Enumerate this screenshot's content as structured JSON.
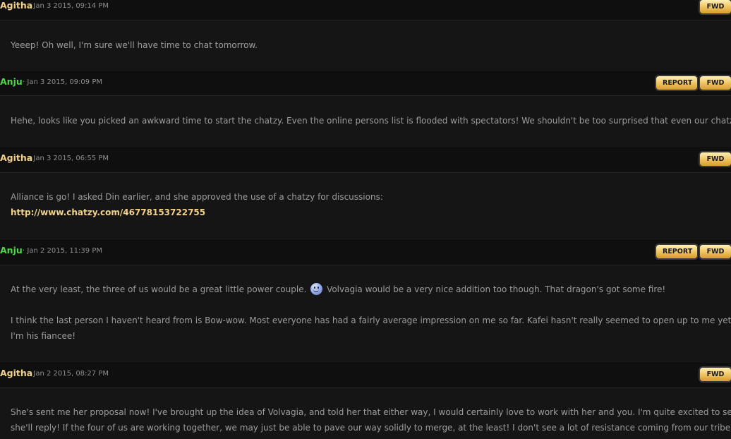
{
  "posts": [
    {
      "author": "Agitha",
      "author_color": "#f2d28a",
      "timestamp": "Jan 3 2015, 09:14 PM",
      "buttons": [
        "FWD"
      ],
      "lines": [
        "Yeeep! Oh well, I'm sure we'll have time to chat tomorrow."
      ]
    },
    {
      "author": "Anju",
      "author_color": "#4fd64a",
      "timestamp": "Jan 3 2015, 09:09 PM",
      "buttons": [
        "REPORT",
        "FWD"
      ],
      "lines": [
        "Hehe, looks like you picked an awkward time to start the chatzy. Even the online persons list is flooded with spectators! We shouldn't be too surprised that even our chatzy is."
      ]
    },
    {
      "author": "Agitha",
      "author_color": "#f2d28a",
      "timestamp": "Jan 3 2015, 06:55 PM",
      "buttons": [
        "FWD"
      ],
      "lines": [
        "Alliance is go! I asked Din earlier, and she approved the use of a chatzy for discussions:"
      ],
      "link": "http://www.chatzy.com/46778153722755"
    },
    {
      "author": "Anju",
      "author_color": "#4fd64a",
      "timestamp": "Jan 2 2015, 11:39 PM",
      "buttons": [
        "REPORT",
        "FWD"
      ],
      "line_before_smiley": "At the very least, the three of us would be a great little power couple.",
      "smiley_icon": "smiley-face-icon",
      "line_after_smiley": "Volvagia would be a very nice addition too though. That dragon's got some fire!",
      "lines": [
        "I think the last person I haven't heard from is Bow-wow. Most everyone has had a fairly average impression on me so far. Kafei hasn't really seemed to open up to me yet. Rude!",
        "I'm his fiancee!"
      ]
    },
    {
      "author": "Agitha",
      "author_color": "#f2d28a",
      "timestamp": "Jan 2 2015, 08:27 PM",
      "buttons": [
        "FWD"
      ],
      "lines": [
        "She's sent me her proposal now! I've brought up the idea of Volvagia, and told her that either way, I would certainly love to work with her and you. I'm quite excited to see how",
        "she'll reply! If the four of us are working together, we may just be able to pave our way solidly to merge, at the least! I don't see a lot of resistance coming from our tribe."
      ]
    }
  ],
  "separator": "·",
  "colors": {
    "background": "#121212",
    "button_gold": "#f2c96a"
  }
}
